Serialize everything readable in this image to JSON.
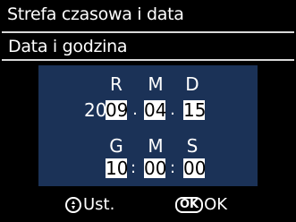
{
  "header": {
    "title": "Strefa czasowa i data"
  },
  "section": {
    "title": "Data i godzina"
  },
  "date": {
    "labels": [
      "R",
      "M",
      "D"
    ],
    "year_prefix": "20",
    "year_editable": "09",
    "month": "04",
    "day": "15",
    "separator": "."
  },
  "time": {
    "labels": [
      "G",
      "M",
      "S"
    ],
    "hour": "10",
    "minute": "00",
    "second": "00",
    "separator": ":"
  },
  "footer": {
    "set_label": "Ust.",
    "ok_icon_text": "OK",
    "ok_label": "OK"
  },
  "colors": {
    "panel": "#1b3257",
    "highlight": "#ffffff"
  },
  "icons": [
    "multi-selector-icon",
    "ok-button-icon"
  ]
}
